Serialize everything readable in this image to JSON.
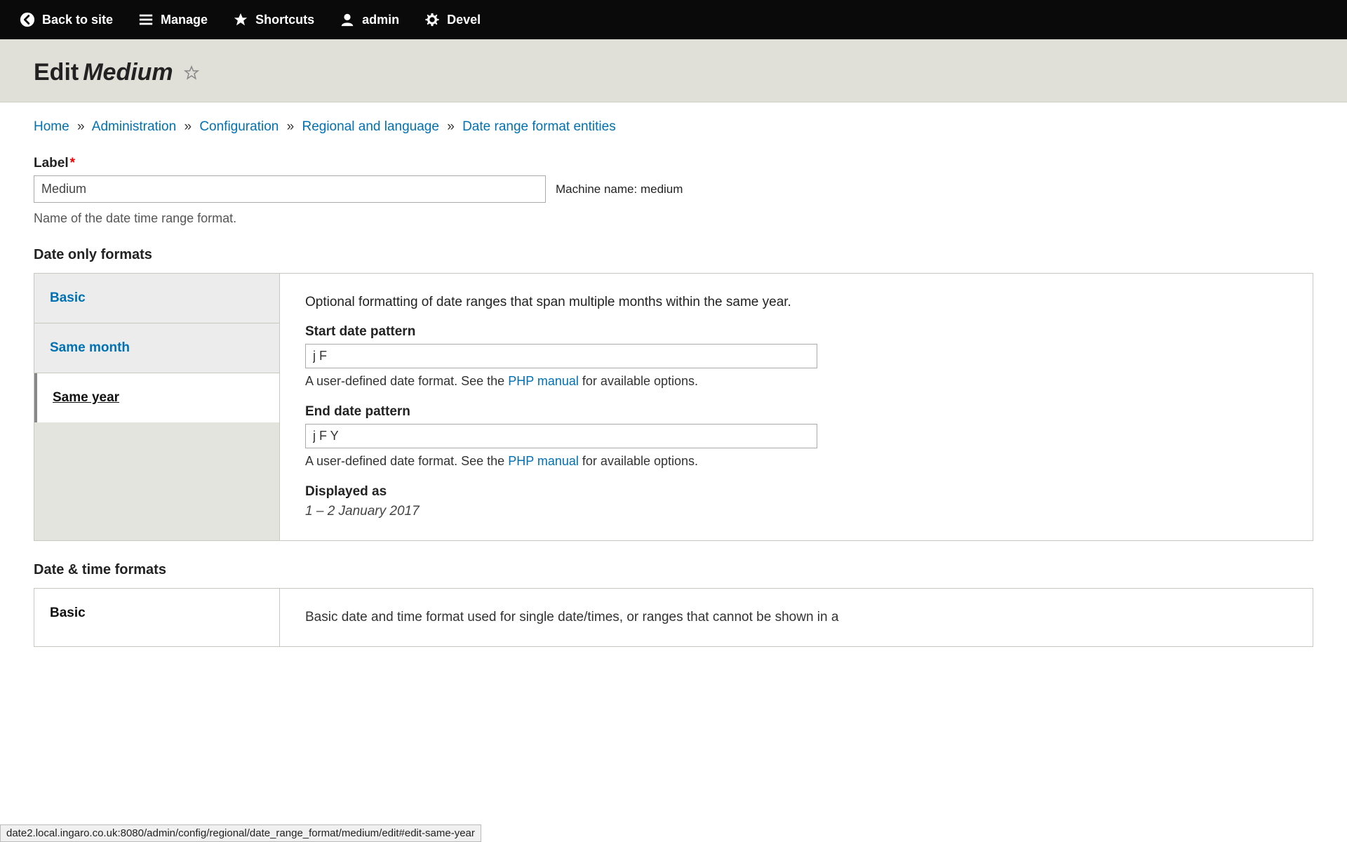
{
  "toolbar": {
    "back": "Back to site",
    "manage": "Manage",
    "shortcuts": "Shortcuts",
    "admin": "admin",
    "devel": "Devel"
  },
  "page": {
    "title_prefix": "Edit",
    "title_em": "Medium"
  },
  "breadcrumb": {
    "home": "Home",
    "admin": "Administration",
    "config": "Configuration",
    "regional": "Regional and language",
    "dateformats": "Date range format entities",
    "sep": "»"
  },
  "label_field": {
    "label": "Label",
    "value": "Medium",
    "machine_prefix": "Machine name: ",
    "machine_name": "medium",
    "help": "Name of the date time range format."
  },
  "section_date_only": "Date only formats",
  "vtabs": {
    "basic": "Basic",
    "same_month": "Same month",
    "same_year": "Same year"
  },
  "tab_content": {
    "intro": "Optional formatting of date ranges that span multiple months within the same year.",
    "start_label": "Start date pattern",
    "start_value": "j F",
    "end_label": "End date pattern",
    "end_value": "j F Y",
    "help_prefix": "A user-defined date format. See the ",
    "help_link": "PHP manual",
    "help_suffix": " for available options.",
    "displayed_label": "Displayed as",
    "displayed_value": "1 – 2 January 2017"
  },
  "section_date_time": "Date & time formats",
  "vtabs2": {
    "basic": "Basic",
    "content": "Basic date and time format used for single date/times, or ranges that cannot be shown in a"
  },
  "statusbar": "date2.local.ingaro.co.uk:8080/admin/config/regional/date_range_format/medium/edit#edit-same-year"
}
